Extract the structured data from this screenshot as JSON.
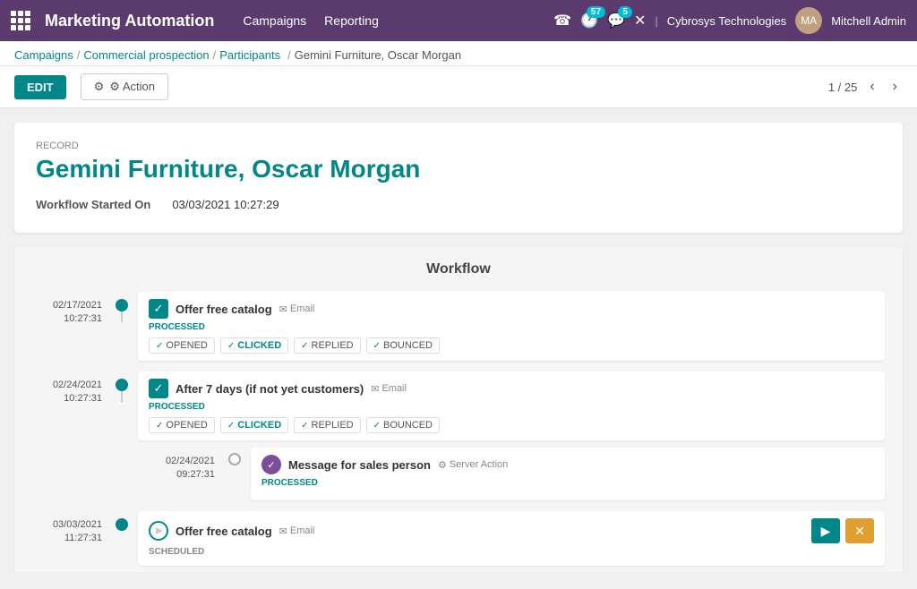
{
  "app": {
    "name": "Marketing Automation",
    "nav": [
      {
        "label": "Campaigns",
        "id": "campaigns"
      },
      {
        "label": "Reporting",
        "id": "reporting"
      }
    ]
  },
  "topbar": {
    "phone_icon": "☎",
    "activity_count": "57",
    "messages_count": "5",
    "close_icon": "✕",
    "company": "Cybrosys Technologies",
    "username": "Mitchell Admin"
  },
  "breadcrumb": {
    "items": [
      {
        "label": "Campaigns",
        "id": "bc-campaigns"
      },
      {
        "label": "Commercial prospection",
        "id": "bc-commercial"
      },
      {
        "label": "Participants",
        "id": "bc-participants"
      },
      {
        "label": "Gemini Furniture, Oscar Morgan",
        "id": "bc-current"
      }
    ]
  },
  "toolbar": {
    "edit_label": "EDIT",
    "action_label": "⚙ Action",
    "pager": "1 / 25"
  },
  "record": {
    "label": "Record",
    "title": "Gemini Furniture, Oscar Morgan",
    "workflow_started_label": "Workflow Started On",
    "workflow_started_value": "03/03/2021 10:27:29"
  },
  "workflow": {
    "title": "Workflow",
    "items": [
      {
        "id": "wf1",
        "date": "02/17/2021",
        "time": "10:27:31",
        "name": "Offer free catalog",
        "type": "Email",
        "type_icon": "✉",
        "status": "PROCESSED",
        "stats": [
          {
            "label": "OPENED",
            "checked": true
          },
          {
            "label": "CLICKED",
            "checked": true,
            "highlighted": true
          },
          {
            "label": "REPLIED",
            "checked": true
          },
          {
            "label": "BOUNCED",
            "checked": true
          }
        ],
        "dot": "teal",
        "checkbox": "checked"
      },
      {
        "id": "wf2",
        "date": "02/24/2021",
        "time": "10:27:31",
        "name": "After 7 days (if not yet customers)",
        "type": "Email",
        "type_icon": "✉",
        "status": "PROCESSED",
        "stats": [
          {
            "label": "OPENED",
            "checked": true
          },
          {
            "label": "CLICKED",
            "checked": true,
            "highlighted": true
          },
          {
            "label": "REPLIED",
            "checked": true
          },
          {
            "label": "BOUNCED",
            "checked": true
          }
        ],
        "dot": "teal",
        "checkbox": "checked",
        "subitem": {
          "date": "02/24/2021",
          "time": "09:27:31",
          "name": "Message for sales person",
          "type": "Server Action",
          "type_icon": "⚙",
          "status": "PROCESSED",
          "dot": "gray",
          "checkbox": "circle"
        }
      },
      {
        "id": "wf3",
        "date": "03/03/2021",
        "time": "11:27:31",
        "name": "Offer free catalog",
        "type": "Email",
        "type_icon": "✉",
        "status": "SCHEDULED",
        "dot": "teal",
        "checkbox": "play",
        "has_actions": true
      }
    ]
  },
  "colors": {
    "teal": "#00878a",
    "purple": "#7c4d99",
    "orange": "#e0a030",
    "teal_light": "#00bcd4"
  }
}
